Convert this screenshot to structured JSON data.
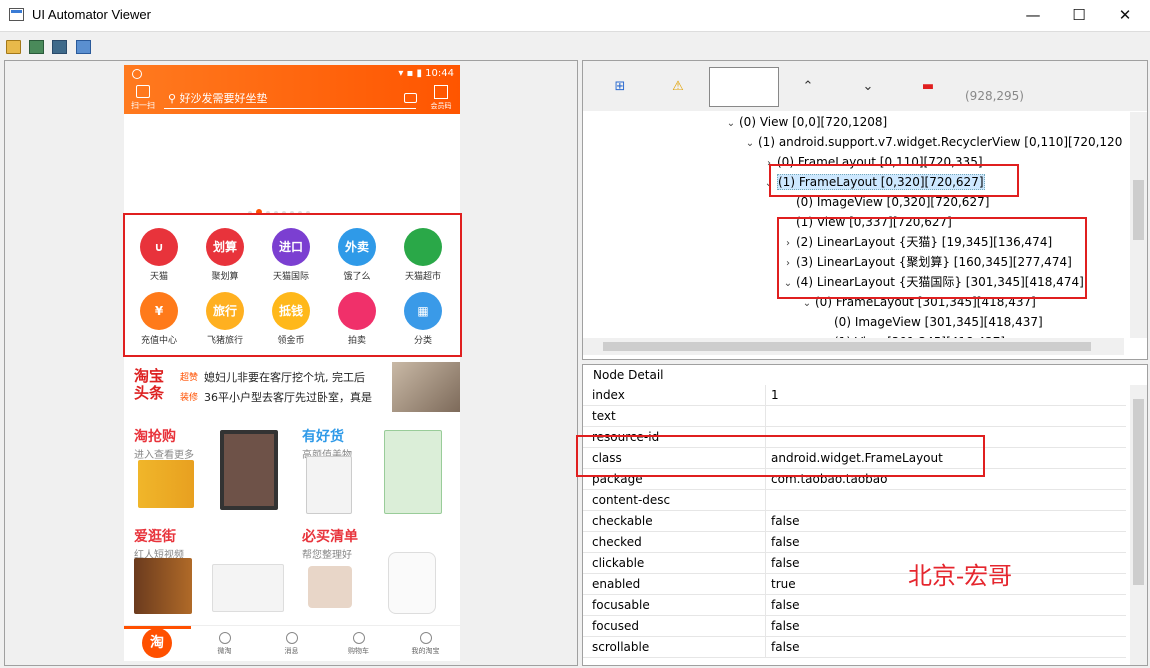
{
  "window": {
    "title": "UI Automator Viewer",
    "minimize": "—",
    "maximize": "☐",
    "close": "✕"
  },
  "toolbar": {
    "icons": [
      "open-folder-icon",
      "device-screenshot-icon",
      "device-screenshot-compressed-icon",
      "save-icon"
    ]
  },
  "phone": {
    "time": "10:44",
    "scan_label": "扫一扫",
    "search_placeholder": "好沙发需要好坐垫",
    "member_label": "会员码",
    "row1": [
      {
        "label": "天猫",
        "color": "#e8333b",
        "glyph": "∪"
      },
      {
        "label": "聚划算",
        "color": "#e8333b",
        "glyph": "划算"
      },
      {
        "label": "天猫国际",
        "color": "#7b3fd1",
        "glyph": "进口"
      },
      {
        "label": "饿了么",
        "color": "#2f9ae8",
        "glyph": "外卖"
      },
      {
        "label": "天猫超市",
        "color": "#2aa848",
        "glyph": ""
      }
    ],
    "row2": [
      {
        "label": "充值中心",
        "color": "#ff7a1a",
        "glyph": "¥"
      },
      {
        "label": "飞猪旅行",
        "color": "#ffb020",
        "glyph": "旅行"
      },
      {
        "label": "领金币",
        "color": "#ffb81a",
        "glyph": "抵钱"
      },
      {
        "label": "拍卖",
        "color": "#f0306a",
        "glyph": ""
      },
      {
        "label": "分类",
        "color": "#3a9ae8",
        "glyph": "▦"
      }
    ],
    "headline": {
      "logo_top": "淘宝",
      "logo_bottom": "头条",
      "tag1": "超赞",
      "line1": "媳妇儿非要在客厅挖个坑, 完工后",
      "tag2": "装修",
      "line2": "36平小户型去客厅先过卧室，真是"
    },
    "grid": [
      {
        "title": "淘抢购",
        "sub": "进入查看更多",
        "color": "#e8333b"
      },
      {
        "title": "有好货",
        "sub": "高颜值美物",
        "color": "#2f9ae8"
      },
      {
        "title": "爱逛街",
        "sub": "红人短视频",
        "color": "#e8333b"
      },
      {
        "title": "必买清单",
        "sub": "帮您整理好",
        "color": "#e8333b"
      }
    ],
    "tabs": [
      "淘",
      "微淘",
      "消息",
      "购物车",
      "我的淘宝"
    ]
  },
  "hierarchy": {
    "coords": "(928,295)",
    "nodes": [
      {
        "text": "(0) View [0,0][720,1208]",
        "arrow": "⌄",
        "indent": 0
      },
      {
        "text": "(1) android.support.v7.widget.RecyclerView [0,110][720,120",
        "arrow": "⌄",
        "indent": 1
      },
      {
        "text": "(0) FrameLayout [0,110][720,335]",
        "arrow": "›",
        "indent": 2
      },
      {
        "text": "(1) FrameLayout [0,320][720,627]",
        "arrow": "⌄",
        "indent": 2
      },
      {
        "text": "(0) ImageView [0,320][720,627]",
        "arrow": "",
        "indent": 3
      },
      {
        "text": "(1) View [0,337][720,627]",
        "arrow": "",
        "indent": 3
      },
      {
        "text": "(2) LinearLayout {天猫} [19,345][136,474]",
        "arrow": "›",
        "indent": 3
      },
      {
        "text": "(3) LinearLayout {聚划算} [160,345][277,474]",
        "arrow": "›",
        "indent": 3
      },
      {
        "text": "(4) LinearLayout {天猫国际} [301,345][418,474]",
        "arrow": "⌄",
        "indent": 3
      },
      {
        "text": "(0) FrameLayout [301,345][418,437]",
        "arrow": "⌄",
        "indent": 4
      },
      {
        "text": "(0) ImageView [301,345][418,437]",
        "arrow": "",
        "indent": 5
      },
      {
        "text": "(1) View [301,345][418,437]",
        "arrow": "",
        "indent": 5
      }
    ]
  },
  "node_detail": {
    "title": "Node Detail",
    "rows": [
      {
        "key": "index",
        "value": "1"
      },
      {
        "key": "text",
        "value": ""
      },
      {
        "key": "resource-id",
        "value": ""
      },
      {
        "key": "class",
        "value": "android.widget.FrameLayout"
      },
      {
        "key": "package",
        "value": "com.taobao.taobao"
      },
      {
        "key": "content-desc",
        "value": ""
      },
      {
        "key": "checkable",
        "value": "false"
      },
      {
        "key": "checked",
        "value": "false"
      },
      {
        "key": "clickable",
        "value": "false"
      },
      {
        "key": "enabled",
        "value": "true"
      },
      {
        "key": "focusable",
        "value": "false"
      },
      {
        "key": "focused",
        "value": "false"
      },
      {
        "key": "scrollable",
        "value": "false"
      }
    ]
  },
  "watermark": "北京-宏哥",
  "colors": {
    "highlight": "#e01f1f",
    "accent": "#ff5000",
    "selection": "#cde8ff"
  }
}
